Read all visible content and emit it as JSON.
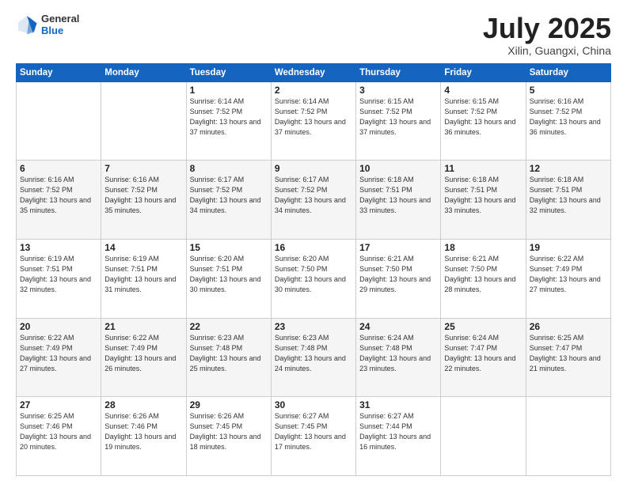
{
  "header": {
    "logo_general": "General",
    "logo_blue": "Blue",
    "month": "July 2025",
    "location": "Xilin, Guangxi, China"
  },
  "weekdays": [
    "Sunday",
    "Monday",
    "Tuesday",
    "Wednesday",
    "Thursday",
    "Friday",
    "Saturday"
  ],
  "weeks": [
    [
      {
        "day": "",
        "info": ""
      },
      {
        "day": "",
        "info": ""
      },
      {
        "day": "1",
        "info": "Sunrise: 6:14 AM\nSunset: 7:52 PM\nDaylight: 13 hours and 37 minutes."
      },
      {
        "day": "2",
        "info": "Sunrise: 6:14 AM\nSunset: 7:52 PM\nDaylight: 13 hours and 37 minutes."
      },
      {
        "day": "3",
        "info": "Sunrise: 6:15 AM\nSunset: 7:52 PM\nDaylight: 13 hours and 37 minutes."
      },
      {
        "day": "4",
        "info": "Sunrise: 6:15 AM\nSunset: 7:52 PM\nDaylight: 13 hours and 36 minutes."
      },
      {
        "day": "5",
        "info": "Sunrise: 6:16 AM\nSunset: 7:52 PM\nDaylight: 13 hours and 36 minutes."
      }
    ],
    [
      {
        "day": "6",
        "info": "Sunrise: 6:16 AM\nSunset: 7:52 PM\nDaylight: 13 hours and 35 minutes."
      },
      {
        "day": "7",
        "info": "Sunrise: 6:16 AM\nSunset: 7:52 PM\nDaylight: 13 hours and 35 minutes."
      },
      {
        "day": "8",
        "info": "Sunrise: 6:17 AM\nSunset: 7:52 PM\nDaylight: 13 hours and 34 minutes."
      },
      {
        "day": "9",
        "info": "Sunrise: 6:17 AM\nSunset: 7:52 PM\nDaylight: 13 hours and 34 minutes."
      },
      {
        "day": "10",
        "info": "Sunrise: 6:18 AM\nSunset: 7:51 PM\nDaylight: 13 hours and 33 minutes."
      },
      {
        "day": "11",
        "info": "Sunrise: 6:18 AM\nSunset: 7:51 PM\nDaylight: 13 hours and 33 minutes."
      },
      {
        "day": "12",
        "info": "Sunrise: 6:18 AM\nSunset: 7:51 PM\nDaylight: 13 hours and 32 minutes."
      }
    ],
    [
      {
        "day": "13",
        "info": "Sunrise: 6:19 AM\nSunset: 7:51 PM\nDaylight: 13 hours and 32 minutes."
      },
      {
        "day": "14",
        "info": "Sunrise: 6:19 AM\nSunset: 7:51 PM\nDaylight: 13 hours and 31 minutes."
      },
      {
        "day": "15",
        "info": "Sunrise: 6:20 AM\nSunset: 7:51 PM\nDaylight: 13 hours and 30 minutes."
      },
      {
        "day": "16",
        "info": "Sunrise: 6:20 AM\nSunset: 7:50 PM\nDaylight: 13 hours and 30 minutes."
      },
      {
        "day": "17",
        "info": "Sunrise: 6:21 AM\nSunset: 7:50 PM\nDaylight: 13 hours and 29 minutes."
      },
      {
        "day": "18",
        "info": "Sunrise: 6:21 AM\nSunset: 7:50 PM\nDaylight: 13 hours and 28 minutes."
      },
      {
        "day": "19",
        "info": "Sunrise: 6:22 AM\nSunset: 7:49 PM\nDaylight: 13 hours and 27 minutes."
      }
    ],
    [
      {
        "day": "20",
        "info": "Sunrise: 6:22 AM\nSunset: 7:49 PM\nDaylight: 13 hours and 27 minutes."
      },
      {
        "day": "21",
        "info": "Sunrise: 6:22 AM\nSunset: 7:49 PM\nDaylight: 13 hours and 26 minutes."
      },
      {
        "day": "22",
        "info": "Sunrise: 6:23 AM\nSunset: 7:48 PM\nDaylight: 13 hours and 25 minutes."
      },
      {
        "day": "23",
        "info": "Sunrise: 6:23 AM\nSunset: 7:48 PM\nDaylight: 13 hours and 24 minutes."
      },
      {
        "day": "24",
        "info": "Sunrise: 6:24 AM\nSunset: 7:48 PM\nDaylight: 13 hours and 23 minutes."
      },
      {
        "day": "25",
        "info": "Sunrise: 6:24 AM\nSunset: 7:47 PM\nDaylight: 13 hours and 22 minutes."
      },
      {
        "day": "26",
        "info": "Sunrise: 6:25 AM\nSunset: 7:47 PM\nDaylight: 13 hours and 21 minutes."
      }
    ],
    [
      {
        "day": "27",
        "info": "Sunrise: 6:25 AM\nSunset: 7:46 PM\nDaylight: 13 hours and 20 minutes."
      },
      {
        "day": "28",
        "info": "Sunrise: 6:26 AM\nSunset: 7:46 PM\nDaylight: 13 hours and 19 minutes."
      },
      {
        "day": "29",
        "info": "Sunrise: 6:26 AM\nSunset: 7:45 PM\nDaylight: 13 hours and 18 minutes."
      },
      {
        "day": "30",
        "info": "Sunrise: 6:27 AM\nSunset: 7:45 PM\nDaylight: 13 hours and 17 minutes."
      },
      {
        "day": "31",
        "info": "Sunrise: 6:27 AM\nSunset: 7:44 PM\nDaylight: 13 hours and 16 minutes."
      },
      {
        "day": "",
        "info": ""
      },
      {
        "day": "",
        "info": ""
      }
    ]
  ]
}
